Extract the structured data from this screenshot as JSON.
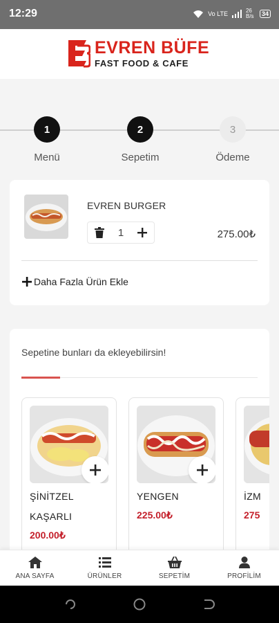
{
  "status_bar": {
    "time": "12:29",
    "network": "Vo LTE",
    "speed": "26 B/s",
    "battery": "34"
  },
  "brand": {
    "name": "EVREN BÜFE",
    "tagline": "FAST FOOD & CAFE",
    "color": "#d9241c"
  },
  "stepper": {
    "steps": [
      {
        "number": "1",
        "label": "Menü",
        "state": "active"
      },
      {
        "number": "2",
        "label": "Sepetim",
        "state": "active"
      },
      {
        "number": "3",
        "label": "Ödeme",
        "state": "inactive"
      }
    ]
  },
  "cart": {
    "items": [
      {
        "name": "EVREN BURGER",
        "quantity": "1",
        "price": "275.00₺"
      }
    ],
    "add_more_label": "Daha Fazla Ürün Ekle"
  },
  "suggestions": {
    "title": "Sepetine bunları da ekleyebilirsin!",
    "products": [
      {
        "name": "ŞİNİTZEL KAŞARLI",
        "price": "200.00₺"
      },
      {
        "name": "YENGEN",
        "price": "225.00₺"
      },
      {
        "name": "İZM",
        "price": "275"
      }
    ]
  },
  "bottom_nav": {
    "items": [
      {
        "label": "ANA SAYFA",
        "icon": "home-icon"
      },
      {
        "label": "ÜRÜNLER",
        "icon": "list-icon"
      },
      {
        "label": "SEPETİM",
        "icon": "basket-icon"
      },
      {
        "label": "PROFİLİM",
        "icon": "user-icon"
      }
    ]
  },
  "colors": {
    "accent_red": "#c4202b",
    "step_active": "#111111"
  }
}
